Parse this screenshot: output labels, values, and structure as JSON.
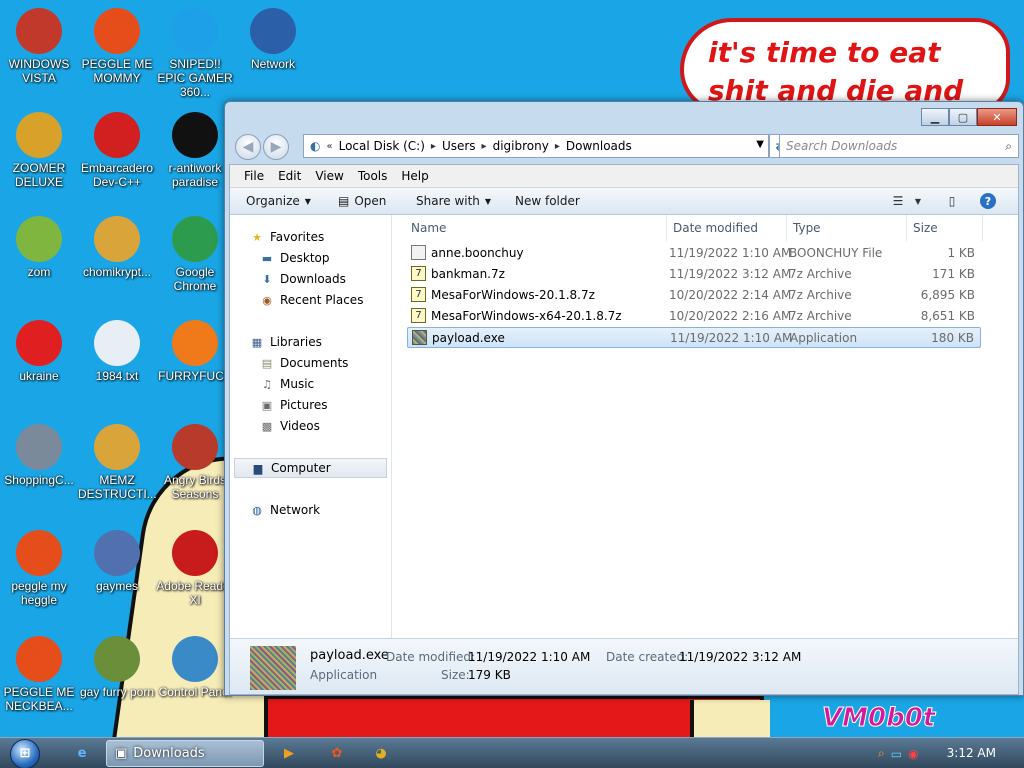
{
  "wallpaper": {
    "bubble_text": "it's time to eat shit and die and chew",
    "signature": "VM0b0t"
  },
  "desktop_icons": [
    {
      "label": "WINDOWS VISTA",
      "icon": "vista-icon",
      "color": "#c0392b"
    },
    {
      "label": "PEGGLE ME MOMMY",
      "icon": "peggle-icon",
      "color": "#e54d1b"
    },
    {
      "label": "SNIPED!! EPIC GAMER 360...",
      "icon": "skype-icon",
      "color": "#1ea0e8"
    },
    {
      "label": "Network",
      "icon": "network-icon",
      "color": "#2b5fa8"
    },
    {
      "label": "ZOOMER DELUXE",
      "icon": "zuma-icon",
      "color": "#d8a12a"
    },
    {
      "label": "Embarcadero Dev-C++",
      "icon": "devcpp-icon",
      "color": "#d21f1f"
    },
    {
      "label": "r-antiwork paradise",
      "icon": "antiwork-icon",
      "color": "#111111"
    },
    {
      "label": "zom",
      "icon": "plant-icon",
      "color": "#7fb640"
    },
    {
      "label": "chomikrypt...",
      "icon": "lockfile-icon",
      "color": "#d9a53a"
    },
    {
      "label": "Google Chrome",
      "icon": "chrome-icon",
      "color": "#2d9b4e"
    },
    {
      "label": "ukraine",
      "icon": "radiation-icon",
      "color": "#e02020"
    },
    {
      "label": "1984.txt",
      "icon": "textfile-icon",
      "color": "#e8eef5"
    },
    {
      "label": "FURRYFUCK",
      "icon": "firefox-icon",
      "color": "#f07a1a"
    },
    {
      "label": "ShoppingC...",
      "icon": "flash-icon",
      "color": "#7a8a9a"
    },
    {
      "label": "MEMZ DESTRUCTI...",
      "icon": "lockfile-icon",
      "color": "#d9a53a"
    },
    {
      "label": "Angry Birds Seasons",
      "icon": "angrybirds-icon",
      "color": "#b83a2a"
    },
    {
      "label": "peggle my heggle",
      "icon": "peggle-icon",
      "color": "#e54d1b"
    },
    {
      "label": "gaymes",
      "icon": "games-icon",
      "color": "#5070b0"
    },
    {
      "label": "Adobe Reader XI",
      "icon": "adobe-icon",
      "color": "#c81b1b"
    },
    {
      "label": "PEGGLE ME NECKBEA...",
      "icon": "peggle-icon",
      "color": "#e54d1b"
    },
    {
      "label": "gay furry porn",
      "icon": "bonzibox-icon",
      "color": "#6b8e3a"
    },
    {
      "label": "Control Panel",
      "icon": "controlpanel-icon",
      "color": "#3a8ac8"
    }
  ],
  "window": {
    "breadcrumb": [
      "Local Disk (C:)",
      "Users",
      "digibrony",
      "Downloads"
    ],
    "search_placeholder": "Search Downloads",
    "menu": [
      "File",
      "Edit",
      "View",
      "Tools",
      "Help"
    ],
    "toolbar": {
      "organize": "Organize",
      "open": "Open",
      "share_with": "Share with",
      "new_folder": "New folder"
    },
    "nav": {
      "favorites": "Favorites",
      "desktop": "Desktop",
      "downloads": "Downloads",
      "recent": "Recent Places",
      "libraries": "Libraries",
      "documents": "Documents",
      "music": "Music",
      "pictures": "Pictures",
      "videos": "Videos",
      "computer": "Computer",
      "network": "Network"
    },
    "columns": {
      "name": "Name",
      "date": "Date modified",
      "type": "Type",
      "size": "Size"
    },
    "files": [
      {
        "name": "anne.boonchuy",
        "date": "11/19/2022 1:10 AM",
        "type": "BOONCHUY File",
        "size": "1 KB",
        "kind": "generic"
      },
      {
        "name": "bankman.7z",
        "date": "11/19/2022 3:12 AM",
        "type": "7z Archive",
        "size": "171 KB",
        "kind": "archive"
      },
      {
        "name": "MesaForWindows-20.1.8.7z",
        "date": "10/20/2022 2:14 AM",
        "type": "7z Archive",
        "size": "6,895 KB",
        "kind": "archive"
      },
      {
        "name": "MesaForWindows-x64-20.1.8.7z",
        "date": "10/20/2022 2:16 AM",
        "type": "7z Archive",
        "size": "8,651 KB",
        "kind": "archive"
      },
      {
        "name": "payload.exe",
        "date": "11/19/2022 1:10 AM",
        "type": "Application",
        "size": "180 KB",
        "kind": "exe"
      }
    ],
    "details": {
      "name": "payload.exe",
      "type": "Application",
      "modified_label": "Date modified:",
      "modified": "11/19/2022 1:10 AM",
      "created_label": "Date created:",
      "created": "11/19/2022 3:12 AM",
      "size_label": "Size:",
      "size": "179 KB"
    }
  },
  "taskbar": {
    "active_window": "Downloads",
    "clock": "3:12 AM"
  }
}
